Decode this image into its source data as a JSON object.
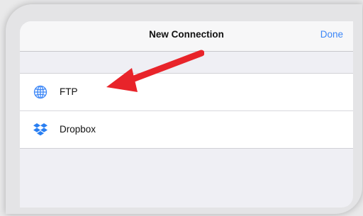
{
  "nav": {
    "title": "New Connection",
    "done_label": "Done"
  },
  "list": {
    "items": [
      {
        "label": "FTP",
        "icon": "globe-icon"
      },
      {
        "label": "Dropbox",
        "icon": "dropbox-icon"
      }
    ]
  },
  "colors": {
    "accent": "#3b86f7",
    "arrow": "#e8242a"
  }
}
